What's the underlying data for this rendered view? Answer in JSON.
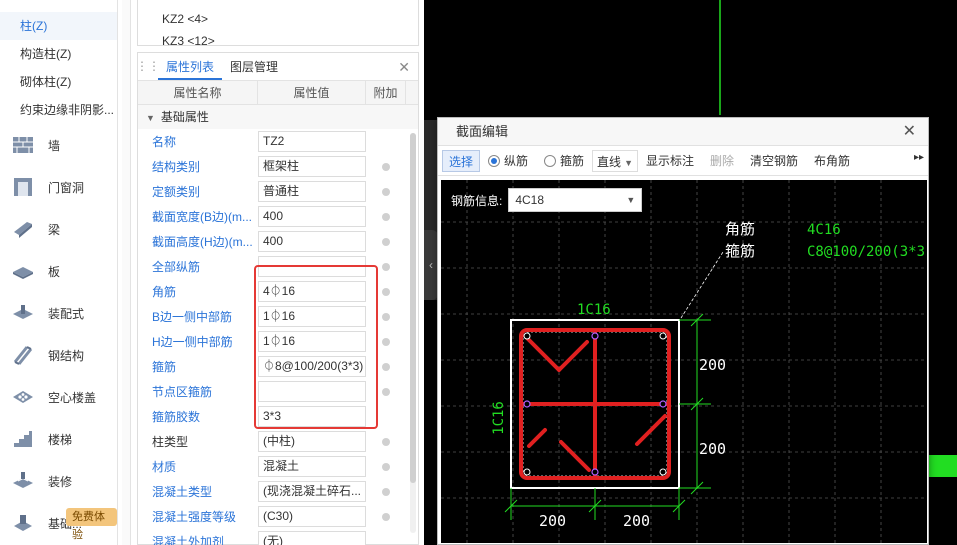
{
  "sidebar": {
    "sub_items": [
      "柱(Z)",
      "构造柱(Z)",
      "砌体柱(Z)",
      "约束边缘非阴影..."
    ],
    "nav_items": [
      {
        "label": "墙",
        "icon": "wall-icon"
      },
      {
        "label": "门窗洞",
        "icon": "door-window-icon"
      },
      {
        "label": "梁",
        "icon": "beam-icon"
      },
      {
        "label": "板",
        "icon": "slab-icon"
      },
      {
        "label": "装配式",
        "icon": "prefab-icon"
      },
      {
        "label": "钢结构",
        "icon": "steel-structure-icon"
      },
      {
        "label": "空心楼盖",
        "icon": "hollow-floor-icon"
      },
      {
        "label": "楼梯",
        "icon": "stairs-icon"
      },
      {
        "label": "装修",
        "icon": "decoration-icon"
      },
      {
        "label": "基础...",
        "icon": "foundation-icon"
      }
    ],
    "free_badge": "免费体验"
  },
  "components": [
    "KZ2 <4>",
    "KZ3 <12>"
  ],
  "props": {
    "tabs": [
      "属性列表",
      "图层管理"
    ],
    "headers": [
      "属性名称",
      "属性值",
      "附加"
    ],
    "group": "基础属性",
    "rows": [
      {
        "name": "名称",
        "value": "TZ2",
        "blue": true,
        "dot": false
      },
      {
        "name": "结构类别",
        "value": "框架柱",
        "blue": true,
        "dot": true
      },
      {
        "name": "定额类别",
        "value": "普通柱",
        "blue": true,
        "dot": true
      },
      {
        "name": "截面宽度(B边)(m...",
        "value": "400",
        "blue": true,
        "dot": true
      },
      {
        "name": "截面高度(H边)(m...",
        "value": "400",
        "blue": true,
        "dot": true
      },
      {
        "name": "全部纵筋",
        "value": "",
        "blue": true,
        "dot": true
      },
      {
        "name": "角筋",
        "value": "4⏀16",
        "blue": true,
        "dot": true
      },
      {
        "name": "B边一侧中部筋",
        "value": "1⏀16",
        "blue": true,
        "dot": true
      },
      {
        "name": "H边一侧中部筋",
        "value": "1⏀16",
        "blue": true,
        "dot": true
      },
      {
        "name": "箍筋",
        "value": "⏀8@100/200(3*3)",
        "blue": true,
        "dot": true
      },
      {
        "name": "节点区箍筋",
        "value": "",
        "blue": true,
        "dot": true
      },
      {
        "name": "箍筋胶数",
        "value": "3*3",
        "blue": true,
        "dot": false
      },
      {
        "name": "柱类型",
        "value": "(中柱)",
        "blue": false,
        "dot": true
      },
      {
        "name": "材质",
        "value": "混凝土",
        "blue": true,
        "dot": true
      },
      {
        "name": "混凝土类型",
        "value": "(现浇混凝土碎石...",
        "blue": true,
        "dot": true
      },
      {
        "name": "混凝土强度等级",
        "value": "(C30)",
        "blue": true,
        "dot": true
      },
      {
        "name": "混凝土外加剂",
        "value": "(无)",
        "blue": true,
        "dot": false
      }
    ]
  },
  "dialog": {
    "title": "截面编辑",
    "toolbar": {
      "select": "选择",
      "longitudinal": "纵筋",
      "stirrup": "箍筋",
      "line": "直线",
      "show_label": "显示标注",
      "delete": "删除",
      "clear": "清空钢筋",
      "corner": "布角筋"
    },
    "rebar_info_label": "钢筋信息:",
    "rebar_info_value": "4C18",
    "drawing": {
      "corner_label": "角筋",
      "stirrup_label": "箍筋",
      "corner_value": "4C16",
      "stirrup_value": "C8@100/200(3*3)",
      "top_label": "1C16",
      "side_label": "1C16",
      "dim_right_1": "200",
      "dim_right_2": "200",
      "dim_bottom_1": "200",
      "dim_bottom_2": "200"
    }
  },
  "colors": {
    "accent_blue": "#2b74d8",
    "highlight_red": "#e53935",
    "cad_green": "#22dd22",
    "rebar_red": "#e02020"
  }
}
